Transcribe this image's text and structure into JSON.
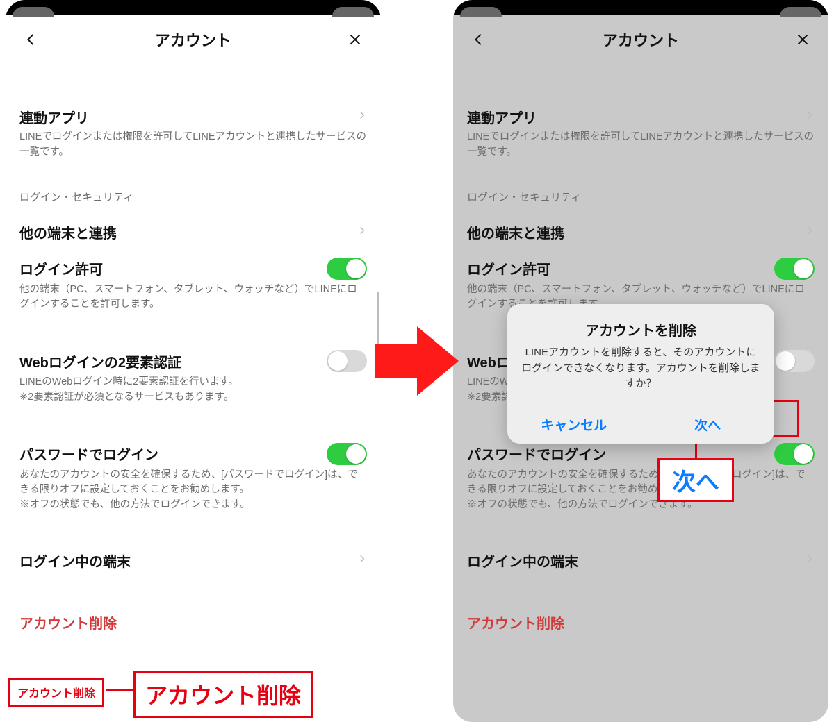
{
  "header": {
    "title": "アカウント"
  },
  "sections": {
    "linked_apps": {
      "title": "連動アプリ",
      "desc": "LINEでログインまたは権限を許可してLINEアカウントと連携したサービスの一覧です。"
    },
    "login_security_label": "ログイン・セキュリティ",
    "other_devices": {
      "title": "他の端末と連携"
    },
    "login_allow": {
      "title": "ログイン許可",
      "desc": "他の端末（PC、スマートフォン、タブレット、ウォッチなど）でLINEにログインすることを許可します。"
    },
    "web_2fa": {
      "title": "Webログインの2要素認証",
      "desc1": "LINEのWebログイン時に2要素認証を行います。",
      "desc2": "※2要素認証が必須となるサービスもあります。"
    },
    "pw_login": {
      "title": "パスワードでログイン",
      "desc1": "あなたのアカウントの安全を確保するため、[パスワードでログイン]は、できる限りオフに設定しておくことをお勧めします。",
      "desc2": "※オフの状態でも、他の方法でログインできます。"
    },
    "logged_in_devices": {
      "title": "ログイン中の端末"
    },
    "delete_account": {
      "title": "アカウント削除"
    }
  },
  "dialog": {
    "title": "アカウントを削除",
    "message": "LINEアカウントを削除すると、そのアカウントにログインできなくなります。アカウントを削除しますか？",
    "cancel": "キャンセル",
    "next": "次へ"
  },
  "callouts": {
    "delete_small": "アカウント削除",
    "delete_big": "アカウント削除",
    "next_big": "次へ"
  },
  "colors": {
    "accent_green": "#2ecc40",
    "danger_red": "#d23b3b",
    "highlight_red": "#e60012",
    "ios_blue": "#0a7cff"
  }
}
